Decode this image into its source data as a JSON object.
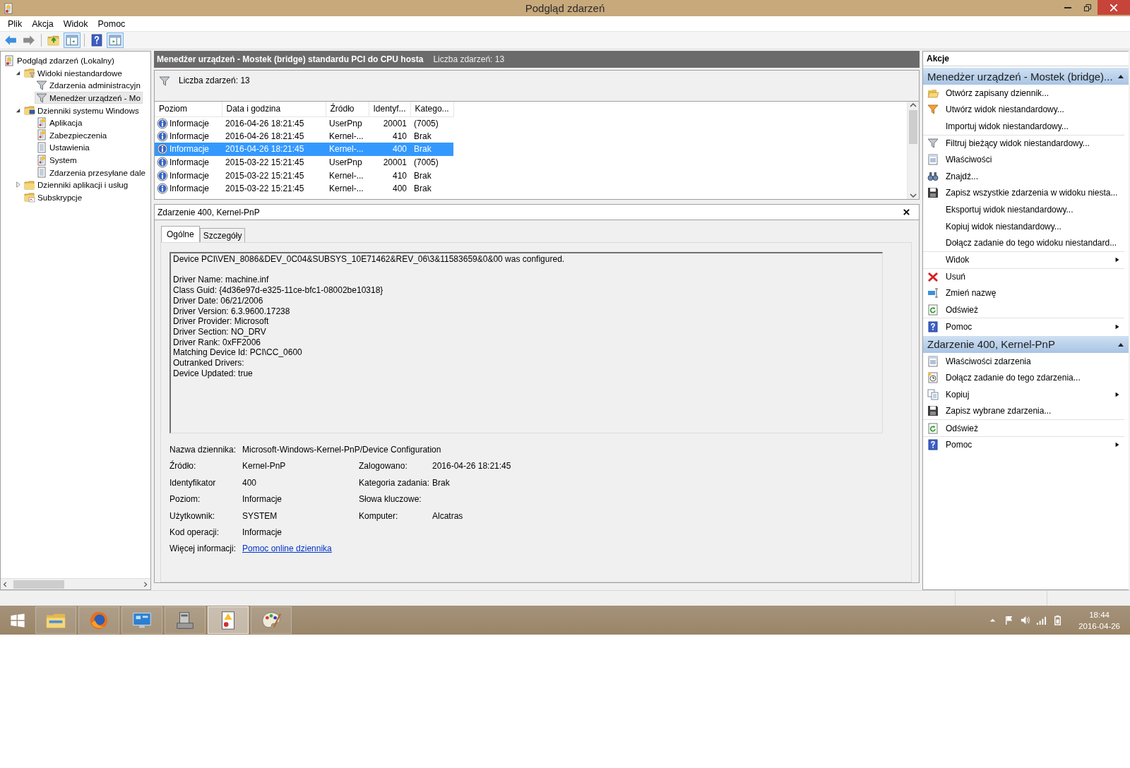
{
  "window": {
    "title": "Podgląd zdarzeń",
    "controls": [
      {
        "kind": "minimize"
      },
      {
        "kind": "restore"
      },
      {
        "kind": "close"
      }
    ]
  },
  "menu": [
    "Plik",
    "Akcja",
    "Widok",
    "Pomoc"
  ],
  "toolbar": [
    [
      {
        "kind": "back",
        "pressed": false
      },
      {
        "kind": "forward",
        "pressed": false
      }
    ],
    [
      {
        "kind": "up-folder",
        "pressed": false
      },
      {
        "kind": "console-tree",
        "pressed": true
      }
    ],
    [
      {
        "kind": "help",
        "pressed": false
      },
      {
        "kind": "action-pane",
        "pressed": true
      }
    ]
  ],
  "tree": [
    {
      "label": "Podgląd zdarzeń (Lokalny)",
      "kind": "root",
      "selected": false,
      "children": [
        {
          "label": "Widoki niestandardowe",
          "kind": "filter-folder",
          "selected": false,
          "expanded": true,
          "children": [
            {
              "label": "Zdarzenia administracyjn",
              "kind": "filter",
              "selected": false
            },
            {
              "label": "Menedżer urządzeń - Mo",
              "kind": "filter",
              "selected": true
            }
          ]
        },
        {
          "label": "Dzienniki systemu Windows",
          "kind": "computer-folder",
          "selected": false,
          "expanded": true,
          "children": [
            {
              "label": "Aplikacja",
              "kind": "log-warning",
              "selected": false
            },
            {
              "label": "Zabezpieczenia",
              "kind": "log-warning",
              "selected": false
            },
            {
              "label": "Ustawienia",
              "kind": "log",
              "selected": false
            },
            {
              "label": "System",
              "kind": "log-warning",
              "selected": false
            },
            {
              "label": "Zdarzenia przesyłane dale",
              "kind": "log",
              "selected": false
            }
          ]
        },
        {
          "label": "Dzienniki aplikacji i usług",
          "kind": "folder",
          "selected": false,
          "expanded": false
        },
        {
          "label": "Subskrypcje",
          "kind": "subscription-folder",
          "selected": false
        }
      ]
    }
  ],
  "center": {
    "header": {
      "title": "Menedżer urządzeń - Mostek (bridge) standardu PCI do CPU hosta",
      "count": "Liczba zdarzeń: 13"
    },
    "filter_text": "Liczba zdarzeń: 13",
    "table": {
      "columns": [
        "Poziom",
        "Data i godzina",
        "Źródło",
        "Identyf...",
        "Katego..."
      ],
      "rows": [
        {
          "cells": [
            "Informacje",
            "2016-04-26 18:21:45",
            "UserPnp",
            "20001",
            "(7005)"
          ],
          "selected": false
        },
        {
          "cells": [
            "Informacje",
            "2016-04-26 18:21:45",
            "Kernel-...",
            "410",
            "Brak"
          ],
          "selected": false
        },
        {
          "cells": [
            "Informacje",
            "2016-04-26 18:21:45",
            "Kernel-...",
            "400",
            "Brak"
          ],
          "selected": true
        },
        {
          "cells": [
            "Informacje",
            "2015-03-22 15:21:45",
            "UserPnp",
            "20001",
            "(7005)"
          ],
          "selected": false
        },
        {
          "cells": [
            "Informacje",
            "2015-03-22 15:21:45",
            "Kernel-...",
            "410",
            "Brak"
          ],
          "selected": false
        },
        {
          "cells": [
            "Informacje",
            "2015-03-22 15:21:45",
            "Kernel-...",
            "400",
            "Brak"
          ],
          "selected": false
        }
      ]
    },
    "details": {
      "title": "Zdarzenie 400, Kernel-PnP",
      "tabs": [
        {
          "label": "Ogólne",
          "selected": true
        },
        {
          "label": "Szczegóły",
          "selected": false
        }
      ],
      "message": {
        "headline": "Device PCI\\VEN_8086&DEV_0C04&SUBSYS_10E71462&REV_06\\3&11583659&0&00 was configured.",
        "lines": [
          "Driver Name: machine.inf",
          "Class Guid: {4d36e97d-e325-11ce-bfc1-08002be10318}",
          "Driver Date: 06/21/2006",
          "Driver Version: 6.3.9600.17238",
          "Driver Provider: Microsoft",
          "Driver Section: NO_DRV",
          "Driver Rank: 0xFF2006",
          "Matching Device Id: PCI\\CC_0600",
          "Outranked Drivers:",
          "Device Updated: true"
        ]
      },
      "fields": [
        {
          "left": {
            "label": "Nazwa dziennika:",
            "value": "Microsoft-Windows-Kernel-PnP/Device Configuration"
          }
        },
        {
          "left": {
            "label": "Źródło:",
            "value": "Kernel-PnP"
          },
          "right": {
            "label": "Zalogowano:",
            "value": "2016-04-26 18:21:45"
          }
        },
        {
          "left": {
            "label": "Identyfikator",
            "value": "400"
          },
          "right": {
            "label": "Kategoria zadania:",
            "value": "Brak"
          }
        },
        {
          "left": {
            "label": "Poziom:",
            "value": "Informacje"
          },
          "right": {
            "label": "Słowa kluczowe:"
          }
        },
        {
          "left": {
            "label": "Użytkownik:",
            "value": "SYSTEM"
          },
          "right": {
            "label": "Komputer:",
            "value": "Alcatras"
          }
        },
        {
          "left": {
            "label": "Kod operacji:",
            "value": "Informacje"
          }
        }
      ],
      "more_info": {
        "label": "Więcej informacji:",
        "link": "Pomoc online dziennika"
      }
    }
  },
  "actions": {
    "title": "Akcje",
    "sections": [
      {
        "title": "Menedżer urządzeń - Mostek (bridge)...",
        "expanded": true,
        "items": [
          {
            "label": "Otwórz zapisany dziennik...",
            "kind": "open",
            "submenu": false,
            "separator_before": false
          },
          {
            "label": "Utwórz widok niestandardowy...",
            "kind": "filter-new",
            "submenu": false,
            "separator_before": false
          },
          {
            "label": "Importuj widok niestandardowy...",
            "kind": "plain",
            "submenu": false,
            "separator_before": false
          },
          {
            "label": "Filtruj bieżący widok niestandardowy...",
            "kind": "filter",
            "submenu": false,
            "separator_before": true
          },
          {
            "label": "Właściwości",
            "kind": "properties",
            "submenu": false,
            "separator_before": false
          },
          {
            "label": "Znajdź...",
            "kind": "find",
            "submenu": false,
            "separator_before": false
          },
          {
            "label": "Zapisz wszystkie zdarzenia w widoku niesta...",
            "kind": "save",
            "submenu": false,
            "separator_before": false
          },
          {
            "label": "Eksportuj widok niestandardowy...",
            "kind": "plain",
            "submenu": false,
            "separator_before": false
          },
          {
            "label": "Kopiuj widok niestandardowy...",
            "kind": "plain",
            "submenu": false,
            "separator_before": false
          },
          {
            "label": "Dołącz zadanie do tego widoku niestandard...",
            "kind": "plain",
            "submenu": false,
            "separator_before": false
          },
          {
            "label": "Widok",
            "kind": "plain",
            "submenu": true,
            "separator_before": true
          },
          {
            "label": "Usuń",
            "kind": "delete",
            "submenu": false,
            "separator_before": true
          },
          {
            "label": "Zmień nazwę",
            "kind": "rename",
            "submenu": false,
            "separator_before": false
          },
          {
            "label": "Odśwież",
            "kind": "refresh",
            "submenu": false,
            "separator_before": false
          },
          {
            "label": "Pomoc",
            "kind": "help",
            "submenu": true,
            "separator_before": true
          }
        ]
      },
      {
        "title": "Zdarzenie 400, Kernel-PnP",
        "expanded": true,
        "items": [
          {
            "label": "Właściwości zdarzenia",
            "kind": "properties",
            "submenu": false,
            "separator_before": false
          },
          {
            "label": "Dołącz zadanie do tego zdarzenia...",
            "kind": "task",
            "submenu": false,
            "separator_before": false
          },
          {
            "label": "Kopiuj",
            "kind": "copy",
            "submenu": true,
            "separator_before": false
          },
          {
            "label": "Zapisz wybrane zdarzenia...",
            "kind": "save",
            "submenu": false,
            "separator_before": false
          },
          {
            "label": "Odśwież",
            "kind": "refresh",
            "submenu": false,
            "separator_before": true
          },
          {
            "label": "Pomoc",
            "kind": "help",
            "submenu": true,
            "separator_before": true
          }
        ]
      }
    ]
  },
  "taskbar": {
    "apps": [
      {
        "kind": "explorer",
        "selected": false
      },
      {
        "kind": "browser",
        "selected": false
      },
      {
        "kind": "control-panel",
        "selected": false
      },
      {
        "kind": "server",
        "selected": false
      },
      {
        "kind": "event-viewer",
        "selected": true
      },
      {
        "kind": "paint",
        "selected": false
      }
    ],
    "tray": [
      {
        "kind": "show-hidden"
      },
      {
        "kind": "flag"
      },
      {
        "kind": "speaker"
      },
      {
        "kind": "signal"
      },
      {
        "kind": "power"
      }
    ],
    "time": "18:44",
    "date": "2016-04-26"
  }
}
